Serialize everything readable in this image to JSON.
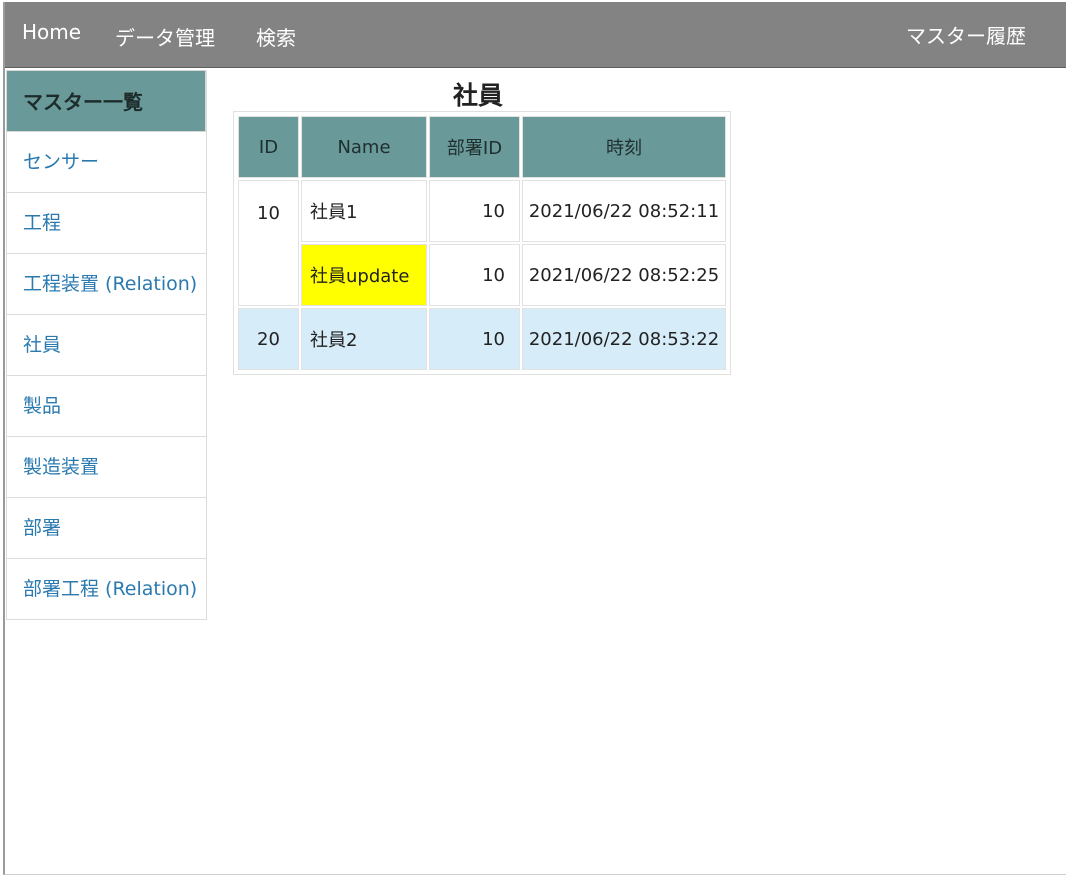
{
  "nav": {
    "home": "Home",
    "data_management": "データ管理",
    "search": "検索",
    "master_history": "マスター履歴"
  },
  "sidebar": {
    "header": "マスター一覧",
    "items": [
      {
        "label": "センサー"
      },
      {
        "label": "工程"
      },
      {
        "label": "工程装置 (Relation)"
      },
      {
        "label": "社員"
      },
      {
        "label": "製品"
      },
      {
        "label": "製造装置"
      },
      {
        "label": "部署"
      },
      {
        "label": "部署工程 (Relation)"
      }
    ]
  },
  "main": {
    "title": "社員",
    "table": {
      "headers": {
        "id": "ID",
        "name": "Name",
        "dept_id": "部署ID",
        "time": "時刻"
      },
      "rows": [
        {
          "id": "10",
          "name": "社員1",
          "dept_id": "10",
          "time": "2021/06/22 08:52:11"
        },
        {
          "id": "",
          "name": "社員update",
          "dept_id": "10",
          "time": "2021/06/22 08:52:25"
        },
        {
          "id": "20",
          "name": "社員2",
          "dept_id": "10",
          "time": "2021/06/22 08:53:22"
        }
      ]
    }
  },
  "colors": {
    "topbar": "#838383",
    "accent_teal": "#699a99",
    "link_blue": "#2a7ab0",
    "highlight_yellow": "#ffff00",
    "selected_row": "#d6ecf9"
  }
}
